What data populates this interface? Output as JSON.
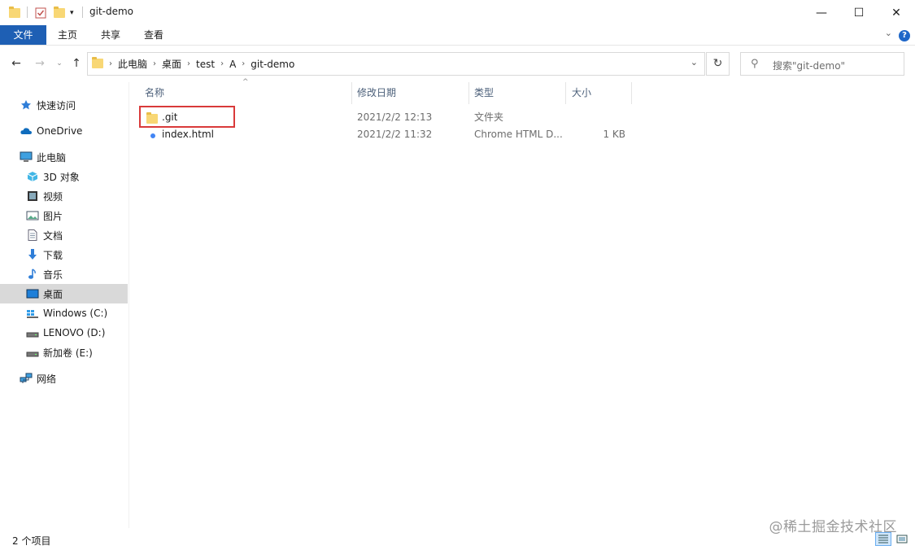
{
  "window": {
    "title": "git-demo",
    "minimize_glyph": "—",
    "maximize_glyph": "☐",
    "close_glyph": "✕"
  },
  "ribbon": {
    "tabs": [
      {
        "label": "文件"
      },
      {
        "label": "主页"
      },
      {
        "label": "共享"
      },
      {
        "label": "查看"
      }
    ],
    "help": "?"
  },
  "address": {
    "crumbs": [
      "此电脑",
      "桌面",
      "test",
      "A",
      "git-demo"
    ],
    "search_placeholder": "搜索\"git-demo\""
  },
  "sidebar": {
    "items": [
      {
        "label": "快速访问",
        "icon": "star-icon"
      },
      {
        "label": "OneDrive",
        "icon": "cloud-icon"
      },
      {
        "label": "此电脑",
        "icon": "computer-icon"
      },
      {
        "label": "3D 对象",
        "icon": "cube-icon"
      },
      {
        "label": "视频",
        "icon": "video-icon"
      },
      {
        "label": "图片",
        "icon": "picture-icon"
      },
      {
        "label": "文档",
        "icon": "document-icon"
      },
      {
        "label": "下载",
        "icon": "download-icon"
      },
      {
        "label": "音乐",
        "icon": "music-icon"
      },
      {
        "label": "桌面",
        "icon": "desktop-icon",
        "selected": true
      },
      {
        "label": "Windows (C:)",
        "icon": "windows-drive-icon"
      },
      {
        "label": "LENOVO (D:)",
        "icon": "drive-icon"
      },
      {
        "label": "新加卷 (E:)",
        "icon": "drive-icon"
      },
      {
        "label": "网络",
        "icon": "network-icon"
      }
    ]
  },
  "list": {
    "columns": [
      "名称",
      "修改日期",
      "类型",
      "大小"
    ],
    "rows": [
      {
        "name": ".git",
        "date": "2021/2/2 12:13",
        "type": "文件夹",
        "size": "",
        "icon": "folder-icon"
      },
      {
        "name": "index.html",
        "date": "2021/2/2 11:32",
        "type": "Chrome HTML D...",
        "size": "1 KB",
        "icon": "chrome-icon"
      }
    ]
  },
  "status": {
    "count": "2 个项目",
    "watermark": "@稀土掘金技术社区"
  },
  "colors": {
    "file_tab": "#1e5fb4",
    "selected": "#d9d9d9",
    "highlight": "#d93a3a"
  }
}
